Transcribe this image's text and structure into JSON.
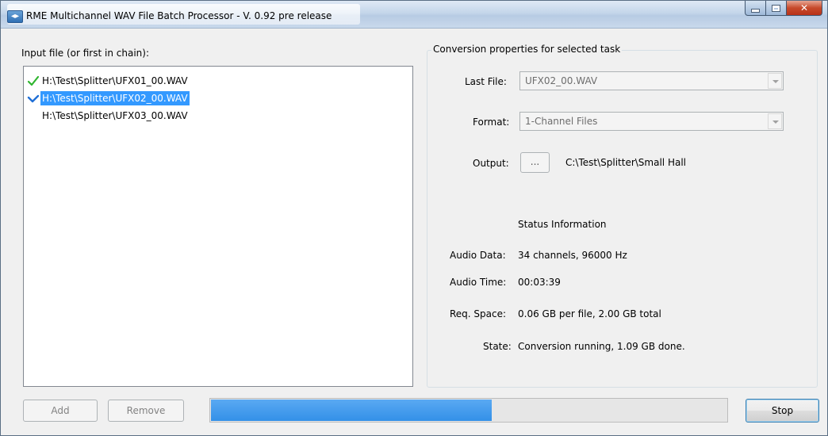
{
  "window": {
    "title": "RME Multichannel WAV File Batch Processor - V. 0.92 pre release",
    "app_icon": "rme-app-icon",
    "caption_buttons": {
      "minimize": "minimize-icon",
      "maximize": "maximize-icon",
      "close": "✕"
    }
  },
  "input_panel": {
    "label": "Input file (or first in chain):",
    "files": [
      {
        "path": "H:\\Test\\Splitter\\UFX01_00.WAV",
        "status_icon": "check-green-icon",
        "selected": false
      },
      {
        "path": "H:\\Test\\Splitter\\UFX02_00.WAV",
        "status_icon": "check-blue-icon",
        "selected": true
      },
      {
        "path": "H:\\Test\\Splitter\\UFX03_00.WAV",
        "status_icon": "",
        "selected": false
      }
    ]
  },
  "properties": {
    "group_title": "Conversion properties for selected task",
    "last_file_label": "Last File:",
    "last_file_value": "UFX02_00.WAV",
    "format_label": "Format:",
    "format_value": "1-Channel Files",
    "output_label": "Output:",
    "output_browse_label": "...",
    "output_path": "C:\\Test\\Splitter\\Small Hall"
  },
  "status": {
    "heading": "Status Information",
    "audio_data_label": "Audio Data:",
    "audio_data_value": "34 channels, 96000 Hz",
    "audio_time_label": "Audio Time:",
    "audio_time_value": "00:03:39",
    "req_space_label": "Req. Space:",
    "req_space_value": "0.06 GB per file, 2.00 GB total",
    "state_label": "State:",
    "state_value": "Conversion running, 1.09 GB done."
  },
  "footer": {
    "add_label": "Add",
    "remove_label": "Remove",
    "stop_label": "Stop",
    "progress_fraction": 0.545
  },
  "colors": {
    "selection": "#3399ff",
    "progress_fill": "#3390e8",
    "check_green": "#2fb52f",
    "check_blue": "#1f6fd6"
  }
}
